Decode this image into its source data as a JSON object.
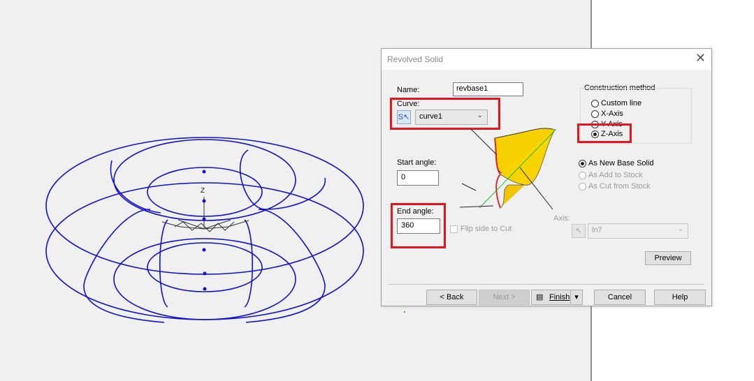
{
  "dialog": {
    "title": "Revolved Solid",
    "close_symbol": "✕",
    "name_label": "Name:",
    "name_value": "revbase1",
    "curve_label": "Curve:",
    "curve_value": "curve1",
    "start_angle_label": "Start angle:",
    "start_angle_value": "0",
    "end_angle_label": "End angle:",
    "end_angle_value": "360",
    "flip_label": "Flip side to Cut",
    "construction_label": "Construction method",
    "construction_options": [
      "Custom line",
      "X-Axis",
      "Y-Axis",
      "Z-Axis"
    ],
    "construction_selected": "Z-Axis",
    "mode_options": [
      "As New Base Solid",
      "As Add to Stock",
      "As Cut from Stock"
    ],
    "mode_selected": "As New Base Solid",
    "axis_label": "Axis:",
    "axis_value": "ln7",
    "preview_label": "Preview",
    "back_label": "< Back",
    "next_label": "Next >",
    "finish_label": "Finish",
    "cancel_label": "Cancel",
    "help_label": "Help"
  },
  "viewport": {
    "axis_label": "Z",
    "wire_color": "#1010d0"
  },
  "colors": {
    "highlight": "#e3161b",
    "yellow_solid": "#f6d000"
  }
}
